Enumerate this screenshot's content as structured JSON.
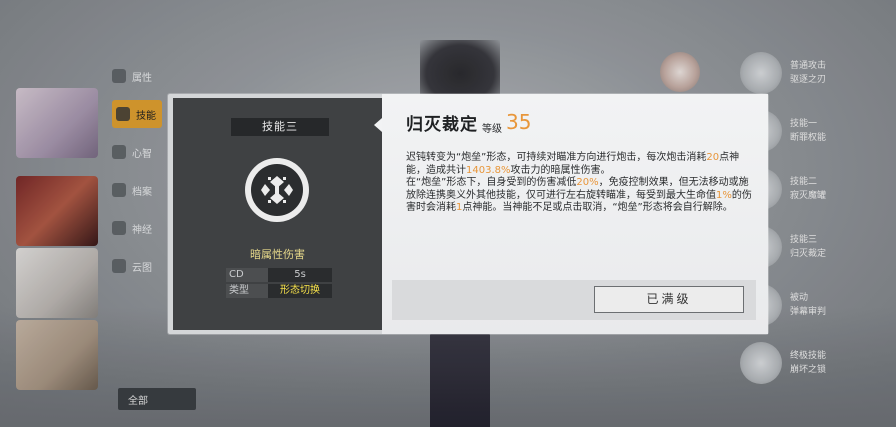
{
  "background": {
    "left_menu": {
      "items": [
        {
          "label": "属性",
          "icon": "stats-icon"
        },
        {
          "label": "技能",
          "icon": "skill-icon",
          "active": true
        },
        {
          "label": "心智",
          "icon": "mind-icon"
        },
        {
          "label": "档案",
          "icon": "archive-icon"
        },
        {
          "label": "神经",
          "icon": "neural-icon"
        },
        {
          "label": "云图",
          "icon": "cloud-icon"
        }
      ],
      "bottom_button": "全部"
    },
    "right_list": [
      {
        "line1": "普通攻击",
        "line2": "驱逐之刃"
      },
      {
        "line1": "技能一",
        "line2": "断罪权能"
      },
      {
        "line1": "技能二",
        "line2": "寂灭魔罐"
      },
      {
        "line1": "技能三",
        "line2": "归灭裁定"
      },
      {
        "line1": "被动",
        "line2": "弹幕审判"
      },
      {
        "line1": "终极技能",
        "line2": "崩坏之锁"
      }
    ]
  },
  "dialog": {
    "skill_tab": "技能三",
    "skill_icon": "artillery-skill-icon",
    "damage_type": "暗属性伤害",
    "stats": [
      {
        "key": "CD",
        "value": "5s"
      },
      {
        "key": "类型",
        "value": "形态切换"
      }
    ],
    "skill_name": "归灭裁定",
    "level_label": "等级",
    "level_value": "35",
    "description": {
      "p1": [
        "迟钝转变为“炮垒”形态，可持续对瞄准方向进行炮击，每次炮击消耗",
        "20",
        "点神能，造成共计",
        "1403.8%",
        "攻击力的暗属性伤害。"
      ],
      "p2": [
        "在“炮垒”形态下，自身受到的伤害减低",
        "20%",
        "，免疫控制效果，但无法移动或施放除连携奥义外其他技能，仅可进行左右旋转瞄准，每受到最大生命值",
        "1%",
        "的伤害时会消耗",
        "1",
        "点神能。当神能不足或点击取消，“炮垒”形态将会自行解除。"
      ]
    },
    "max_button": "已满级"
  },
  "colors": {
    "accent": "#e8963a",
    "type_highlight": "#f5e04a",
    "damage_type": "#e6d88a"
  }
}
